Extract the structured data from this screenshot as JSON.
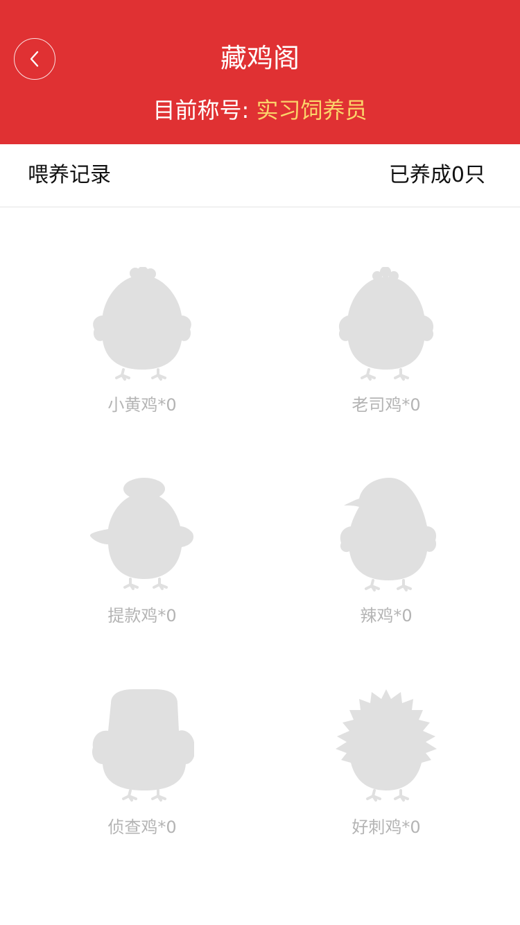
{
  "header": {
    "title": "藏鸡阁",
    "subtitle_prefix": "目前称号: ",
    "subtitle_rank": "实习饲养员",
    "bg_color": "#e03133",
    "rank_color": "#fbd46a",
    "back_icon": "chevron-left-icon"
  },
  "record": {
    "left_label": "喂养记录",
    "right_label": "已养成0只"
  },
  "chickens": [
    {
      "label": "小黄鸡*0",
      "icon": "chick-silhouette-icon"
    },
    {
      "label": "老司鸡*0",
      "icon": "chick-silhouette-icon"
    },
    {
      "label": "提款鸡*0",
      "icon": "chick-bun-silhouette-icon"
    },
    {
      "label": "辣鸡*0",
      "icon": "chick-crest-silhouette-icon"
    },
    {
      "label": "侦查鸡*0",
      "icon": "chick-hat-silhouette-icon"
    },
    {
      "label": "好刺鸡*0",
      "icon": "chick-spiky-silhouette-icon"
    }
  ]
}
